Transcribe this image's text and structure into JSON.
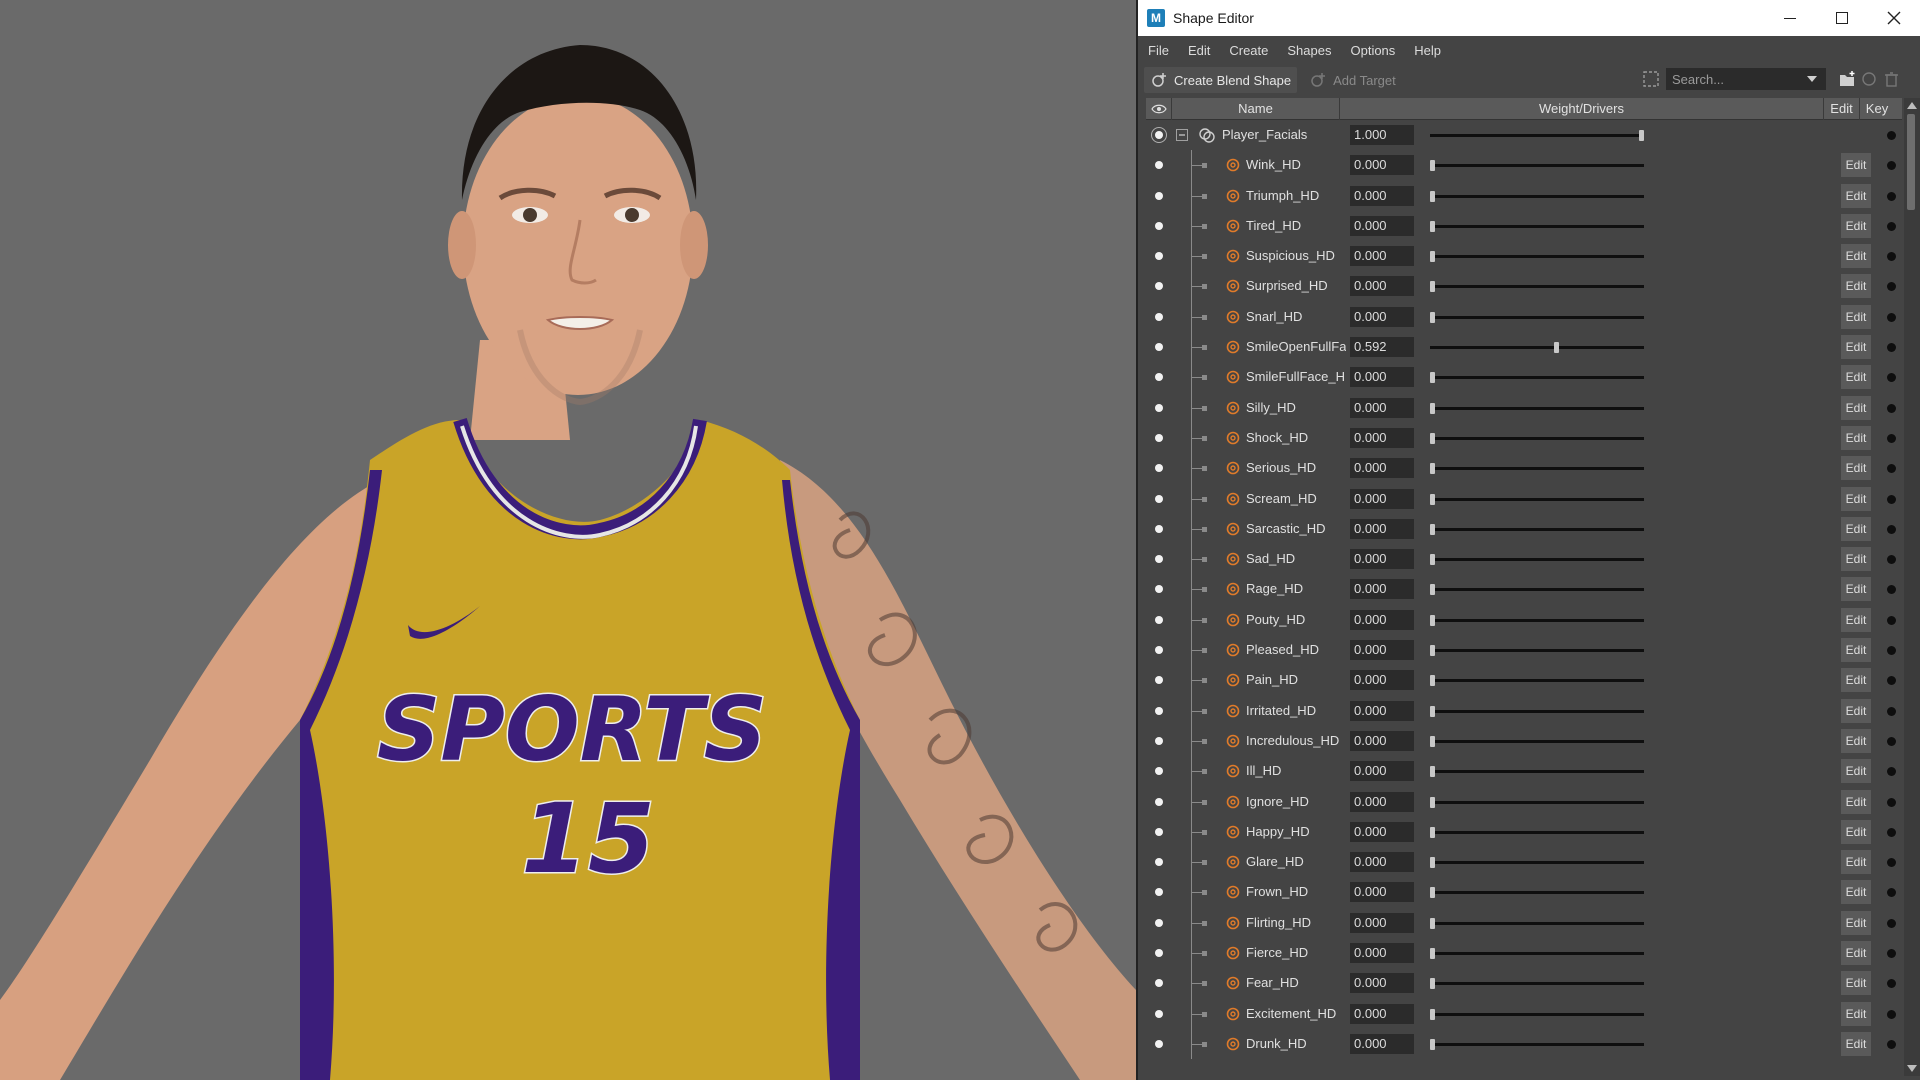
{
  "window": {
    "title": "Shape Editor",
    "app_icon": "M"
  },
  "menu": [
    "File",
    "Edit",
    "Create",
    "Shapes",
    "Options",
    "Help"
  ],
  "toolbar": {
    "create_blend_shape": "Create Blend Shape",
    "add_target": "Add Target",
    "search_placeholder": "Search..."
  },
  "columns": {
    "name": "Name",
    "weight": "Weight/Drivers",
    "edit": "Edit",
    "key": "Key"
  },
  "colors": {
    "accent_target_icon": "#e07b2a",
    "jersey_gold": "#c9a428",
    "jersey_purple": "#3b1d7a"
  },
  "viewport": {
    "jersey_text": "SPORTS",
    "jersey_number": "15"
  },
  "blend_shape": {
    "name": "Player_Facials",
    "weight": "1.000",
    "level": 1.0
  },
  "targets": [
    {
      "name": "Wink_HD",
      "weight": "0.000",
      "level": 0,
      "edit": "Edit"
    },
    {
      "name": "Triumph_HD",
      "weight": "0.000",
      "level": 0,
      "edit": "Edit"
    },
    {
      "name": "Tired_HD",
      "weight": "0.000",
      "level": 0,
      "edit": "Edit"
    },
    {
      "name": "Suspicious_HD",
      "weight": "0.000",
      "level": 0,
      "edit": "Edit"
    },
    {
      "name": "Surprised_HD",
      "weight": "0.000",
      "level": 0,
      "edit": "Edit"
    },
    {
      "name": "Snarl_HD",
      "weight": "0.000",
      "level": 0,
      "edit": "Edit"
    },
    {
      "name": "SmileOpenFullFa",
      "weight": "0.592",
      "level": 0.592,
      "edit": "Edit"
    },
    {
      "name": "SmileFullFace_H",
      "weight": "0.000",
      "level": 0,
      "edit": "Edit"
    },
    {
      "name": "Silly_HD",
      "weight": "0.000",
      "level": 0,
      "edit": "Edit"
    },
    {
      "name": "Shock_HD",
      "weight": "0.000",
      "level": 0,
      "edit": "Edit"
    },
    {
      "name": "Serious_HD",
      "weight": "0.000",
      "level": 0,
      "edit": "Edit"
    },
    {
      "name": "Scream_HD",
      "weight": "0.000",
      "level": 0,
      "edit": "Edit"
    },
    {
      "name": "Sarcastic_HD",
      "weight": "0.000",
      "level": 0,
      "edit": "Edit"
    },
    {
      "name": "Sad_HD",
      "weight": "0.000",
      "level": 0,
      "edit": "Edit"
    },
    {
      "name": "Rage_HD",
      "weight": "0.000",
      "level": 0,
      "edit": "Edit"
    },
    {
      "name": "Pouty_HD",
      "weight": "0.000",
      "level": 0,
      "edit": "Edit"
    },
    {
      "name": "Pleased_HD",
      "weight": "0.000",
      "level": 0,
      "edit": "Edit"
    },
    {
      "name": "Pain_HD",
      "weight": "0.000",
      "level": 0,
      "edit": "Edit"
    },
    {
      "name": "Irritated_HD",
      "weight": "0.000",
      "level": 0,
      "edit": "Edit"
    },
    {
      "name": "Incredulous_HD",
      "weight": "0.000",
      "level": 0,
      "edit": "Edit"
    },
    {
      "name": "Ill_HD",
      "weight": "0.000",
      "level": 0,
      "edit": "Edit"
    },
    {
      "name": "Ignore_HD",
      "weight": "0.000",
      "level": 0,
      "edit": "Edit"
    },
    {
      "name": "Happy_HD",
      "weight": "0.000",
      "level": 0,
      "edit": "Edit"
    },
    {
      "name": "Glare_HD",
      "weight": "0.000",
      "level": 0,
      "edit": "Edit"
    },
    {
      "name": "Frown_HD",
      "weight": "0.000",
      "level": 0,
      "edit": "Edit"
    },
    {
      "name": "Flirting_HD",
      "weight": "0.000",
      "level": 0,
      "edit": "Edit"
    },
    {
      "name": "Fierce_HD",
      "weight": "0.000",
      "level": 0,
      "edit": "Edit"
    },
    {
      "name": "Fear_HD",
      "weight": "0.000",
      "level": 0,
      "edit": "Edit"
    },
    {
      "name": "Excitement_HD",
      "weight": "0.000",
      "level": 0,
      "edit": "Edit"
    },
    {
      "name": "Drunk_HD",
      "weight": "0.000",
      "level": 0,
      "edit": "Edit"
    }
  ]
}
